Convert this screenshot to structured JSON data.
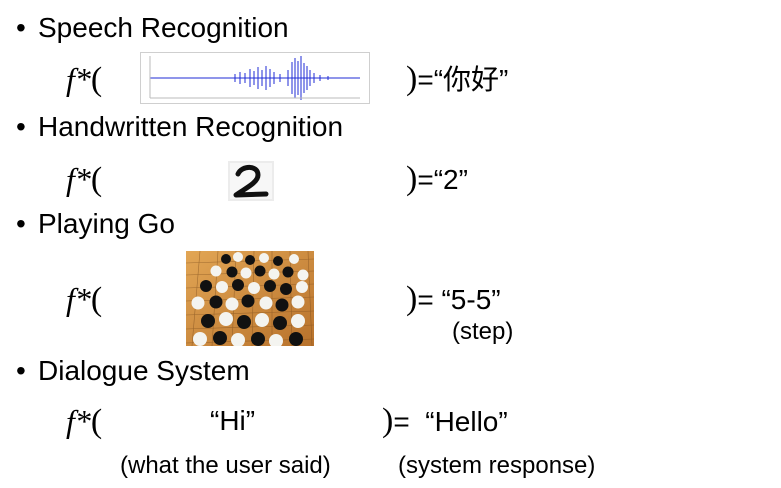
{
  "bullet_symbol": "•",
  "function_label": "f",
  "function_star": "*",
  "open_paren": "(",
  "close_paren": ")",
  "equals": "=",
  "sections": [
    {
      "heading": "Speech Recognition",
      "output": "“你好”"
    },
    {
      "heading": "Handwritten Recognition",
      "output": "“2”"
    },
    {
      "heading": "Playing Go",
      "output": "“5-5”",
      "output_note": "(step)"
    },
    {
      "heading": "Dialogue System",
      "input": "“Hi”",
      "input_note": "(what the user said)",
      "output": "“Hello”",
      "output_note": "(system response)"
    }
  ],
  "colors": {
    "waveform": "#1f2bd6",
    "go_board": "#c98a3a",
    "digit_bg": "#ececec"
  }
}
